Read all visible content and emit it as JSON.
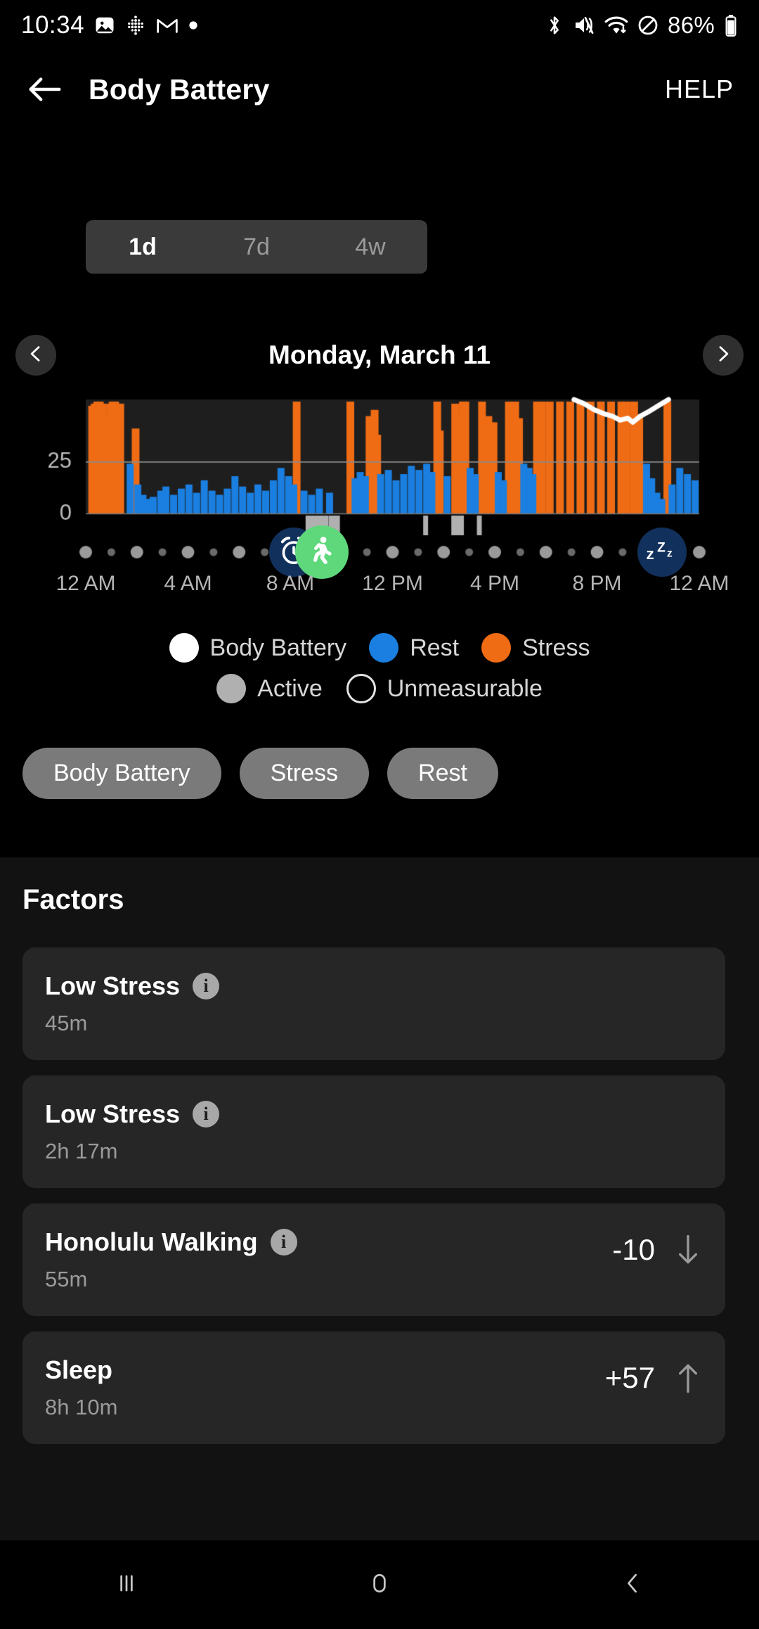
{
  "status_bar": {
    "time": "10:34",
    "battery_percent": "86%",
    "left_icons": [
      "image-icon",
      "dots-grid-icon",
      "gmail-icon",
      "dot-icon"
    ],
    "right_icons": [
      "bluetooth-icon",
      "mute-icon",
      "wifi-icon",
      "do-not-disturb-icon",
      "battery-icon"
    ]
  },
  "app_bar": {
    "back": "back-arrow-icon",
    "title": "Body Battery",
    "help_label": "HELP"
  },
  "range_selector": {
    "options": [
      {
        "label": "1d",
        "selected": true
      },
      {
        "label": "7d",
        "selected": false
      },
      {
        "label": "4w",
        "selected": false
      }
    ]
  },
  "date_nav": {
    "prev": "chevron-left-icon",
    "next": "chevron-right-icon",
    "date": "Monday, March 11"
  },
  "legend": {
    "row1": [
      {
        "label": "Body Battery",
        "color": "#ffffff",
        "style": "solid"
      },
      {
        "label": "Rest",
        "color": "#1a7fe0",
        "style": "solid"
      },
      {
        "label": "Stress",
        "color": "#ef6c15",
        "style": "solid"
      }
    ],
    "row2": [
      {
        "label": "Active",
        "color": "#b0b0b0",
        "style": "solid"
      },
      {
        "label": "Unmeasurable",
        "color": "transparent",
        "style": "hollow"
      }
    ]
  },
  "chips": [
    {
      "label": "Body Battery"
    },
    {
      "label": "Stress"
    },
    {
      "label": "Rest"
    }
  ],
  "factors": {
    "title": "Factors",
    "items": [
      {
        "name": "Low Stress",
        "duration": "45m",
        "value": "",
        "trend": "",
        "has_info": true
      },
      {
        "name": "Low Stress",
        "duration": "2h 17m",
        "value": "",
        "trend": "",
        "has_info": true
      },
      {
        "name": "Honolulu Walking",
        "duration": "55m",
        "value": "-10",
        "trend": "down",
        "has_info": true
      },
      {
        "name": "Sleep",
        "duration": "8h 10m",
        "value": "+57",
        "trend": "up",
        "has_info": false
      }
    ]
  },
  "nav_bar": {
    "recents": "recents-icon",
    "home": "home-icon",
    "back": "back-icon"
  },
  "chart_data": {
    "type": "bar",
    "title": "Body Battery / Stress / Rest — Monday, March 11",
    "xlabel": "",
    "ylabel": "",
    "ylim": [
      0,
      55
    ],
    "y_ticks": [
      0,
      25
    ],
    "y_tick_labels": [
      "0",
      "25"
    ],
    "grid": true,
    "x_tick_labels": [
      "12 AM",
      "4 AM",
      "8 AM",
      "12 PM",
      "4 PM",
      "8 PM",
      "12 AM"
    ],
    "x_range_hours": [
      0,
      24
    ],
    "legend_position": "below",
    "colors": {
      "rest": "#1a7fe0",
      "stress": "#ef6c15",
      "body_battery": "#ffffff",
      "active": "#b0b0b0",
      "unmeasurable": "#1c1c1c",
      "plot_background": "#1e1e1e",
      "gridline": "#8a8a8a"
    },
    "series": [
      {
        "name": "Stress",
        "type": "bar",
        "color": "#ef6c15",
        "note": "orange vertical bars; value = stress level",
        "bars": [
          {
            "t": 0.1,
            "v": 52
          },
          {
            "t": 0.2,
            "v": 53
          },
          {
            "t": 0.3,
            "v": 54
          },
          {
            "t": 0.4,
            "v": 54
          },
          {
            "t": 0.5,
            "v": 53
          },
          {
            "t": 0.6,
            "v": 48
          },
          {
            "t": 0.7,
            "v": 44
          },
          {
            "t": 0.8,
            "v": 53
          },
          {
            "t": 0.9,
            "v": 54
          },
          {
            "t": 1.0,
            "v": 54
          },
          {
            "t": 1.1,
            "v": 42
          },
          {
            "t": 1.2,
            "v": 53
          },
          {
            "t": 1.8,
            "v": 41
          },
          {
            "t": 8.1,
            "v": 54
          },
          {
            "t": 10.2,
            "v": 54
          },
          {
            "t": 10.95,
            "v": 47
          },
          {
            "t": 11.05,
            "v": 44
          },
          {
            "t": 11.15,
            "v": 50
          },
          {
            "t": 11.25,
            "v": 38
          },
          {
            "t": 13.6,
            "v": 54
          },
          {
            "t": 13.7,
            "v": 40
          },
          {
            "t": 14.3,
            "v": 53
          },
          {
            "t": 14.45,
            "v": 46
          },
          {
            "t": 14.6,
            "v": 54
          },
          {
            "t": 14.7,
            "v": 54
          },
          {
            "t": 15.35,
            "v": 54
          },
          {
            "t": 15.6,
            "v": 47
          },
          {
            "t": 15.8,
            "v": 44
          },
          {
            "t": 16.4,
            "v": 54
          },
          {
            "t": 16.5,
            "v": 44
          },
          {
            "t": 16.65,
            "v": 54
          },
          {
            "t": 16.8,
            "v": 46
          },
          {
            "t": 17.5,
            "v": 54
          },
          {
            "t": 17.7,
            "v": 54
          },
          {
            "t": 18.0,
            "v": 54
          },
          {
            "t": 18.4,
            "v": 54
          },
          {
            "t": 18.8,
            "v": 54
          },
          {
            "t": 19.2,
            "v": 54
          },
          {
            "t": 19.6,
            "v": 54
          },
          {
            "t": 20.0,
            "v": 54
          },
          {
            "t": 20.4,
            "v": 54
          },
          {
            "t": 20.8,
            "v": 54
          },
          {
            "t": 21.0,
            "v": 54
          },
          {
            "t": 21.3,
            "v": 54
          },
          {
            "t": 21.5,
            "v": 48
          },
          {
            "t": 22.6,
            "v": 54
          }
        ]
      },
      {
        "name": "Rest",
        "type": "bar",
        "color": "#1a7fe0",
        "note": "blue vertical bars; value = rest level",
        "bars": [
          {
            "t": 1.6,
            "v": 24
          },
          {
            "t": 1.9,
            "v": 14
          },
          {
            "t": 2.1,
            "v": 9
          },
          {
            "t": 2.3,
            "v": 7
          },
          {
            "t": 2.5,
            "v": 8
          },
          {
            "t": 2.8,
            "v": 11
          },
          {
            "t": 3.0,
            "v": 13
          },
          {
            "t": 3.3,
            "v": 9
          },
          {
            "t": 3.6,
            "v": 12
          },
          {
            "t": 3.9,
            "v": 14
          },
          {
            "t": 4.2,
            "v": 10
          },
          {
            "t": 4.5,
            "v": 16
          },
          {
            "t": 4.8,
            "v": 11
          },
          {
            "t": 5.1,
            "v": 9
          },
          {
            "t": 5.4,
            "v": 12
          },
          {
            "t": 5.7,
            "v": 18
          },
          {
            "t": 6.0,
            "v": 13
          },
          {
            "t": 6.3,
            "v": 10
          },
          {
            "t": 6.6,
            "v": 14
          },
          {
            "t": 6.9,
            "v": 11
          },
          {
            "t": 7.2,
            "v": 16
          },
          {
            "t": 7.5,
            "v": 22
          },
          {
            "t": 7.8,
            "v": 18
          },
          {
            "t": 8.0,
            "v": 14
          },
          {
            "t": 8.4,
            "v": 11
          },
          {
            "t": 8.7,
            "v": 9
          },
          {
            "t": 9.0,
            "v": 12
          },
          {
            "t": 9.4,
            "v": 10
          },
          {
            "t": 10.4,
            "v": 17
          },
          {
            "t": 10.6,
            "v": 20
          },
          {
            "t": 10.8,
            "v": 18
          },
          {
            "t": 11.4,
            "v": 19
          },
          {
            "t": 11.7,
            "v": 21
          },
          {
            "t": 12.0,
            "v": 16
          },
          {
            "t": 12.3,
            "v": 19
          },
          {
            "t": 12.6,
            "v": 23
          },
          {
            "t": 12.9,
            "v": 21
          },
          {
            "t": 13.2,
            "v": 24
          },
          {
            "t": 13.4,
            "v": 20
          },
          {
            "t": 14.0,
            "v": 18
          },
          {
            "t": 14.9,
            "v": 22
          },
          {
            "t": 15.1,
            "v": 19
          },
          {
            "t": 16.0,
            "v": 20
          },
          {
            "t": 16.2,
            "v": 16
          },
          {
            "t": 17.0,
            "v": 24
          },
          {
            "t": 17.2,
            "v": 22
          },
          {
            "t": 17.35,
            "v": 19
          },
          {
            "t": 21.8,
            "v": 24
          },
          {
            "t": 22.0,
            "v": 17
          },
          {
            "t": 22.2,
            "v": 10
          },
          {
            "t": 22.4,
            "v": 7
          },
          {
            "t": 22.8,
            "v": 14
          },
          {
            "t": 23.1,
            "v": 22
          },
          {
            "t": 23.4,
            "v": 19
          },
          {
            "t": 23.7,
            "v": 16
          }
        ]
      },
      {
        "name": "Body Battery",
        "type": "line",
        "color": "#ffffff",
        "note": "white line, only plotted over right portion of day",
        "points": [
          {
            "t": 19.1,
            "v": 55
          },
          {
            "t": 19.5,
            "v": 53
          },
          {
            "t": 19.9,
            "v": 50
          },
          {
            "t": 20.3,
            "v": 48
          },
          {
            "t": 20.6,
            "v": 47
          },
          {
            "t": 20.9,
            "v": 45
          },
          {
            "t": 21.2,
            "v": 46
          },
          {
            "t": 21.4,
            "v": 44
          },
          {
            "t": 21.7,
            "v": 47
          },
          {
            "t": 22.0,
            "v": 49
          },
          {
            "t": 22.4,
            "v": 52
          },
          {
            "t": 22.8,
            "v": 55
          }
        ]
      },
      {
        "name": "Active",
        "type": "strip",
        "color": "#b0b0b0",
        "note": "light gray ticks in strip below the main plot",
        "bars": [
          {
            "t": 8.6,
            "v": 1
          },
          {
            "t": 8.7,
            "v": 1
          },
          {
            "t": 8.8,
            "v": 1
          },
          {
            "t": 8.9,
            "v": 1
          },
          {
            "t": 9.0,
            "v": 1
          },
          {
            "t": 9.1,
            "v": 1
          },
          {
            "t": 9.2,
            "v": 1
          },
          {
            "t": 9.3,
            "v": 1
          },
          {
            "t": 9.5,
            "v": 1
          },
          {
            "t": 9.6,
            "v": 1
          },
          {
            "t": 9.75,
            "v": 1
          },
          {
            "t": 13.2,
            "v": 1
          },
          {
            "t": 14.3,
            "v": 1
          },
          {
            "t": 14.45,
            "v": 1
          },
          {
            "t": 14.6,
            "v": 1
          },
          {
            "t": 15.3,
            "v": 1
          }
        ]
      }
    ],
    "markers": [
      {
        "t": 8.15,
        "icon": "alarm-clock-icon",
        "color": "#12305c",
        "label": "wake"
      },
      {
        "t": 9.25,
        "icon": "walking-person-icon",
        "color": "#5ed87b",
        "label": "activity"
      },
      {
        "t": 22.55,
        "icon": "sleep-zzz-icon",
        "color": "#12305c",
        "label": "sleep"
      }
    ],
    "hour_dots": {
      "major_color": "#9a9a9a",
      "minor_color": "#6a6a6a",
      "count": 25,
      "note": "one dot per hour; dots at even hours are larger"
    }
  }
}
